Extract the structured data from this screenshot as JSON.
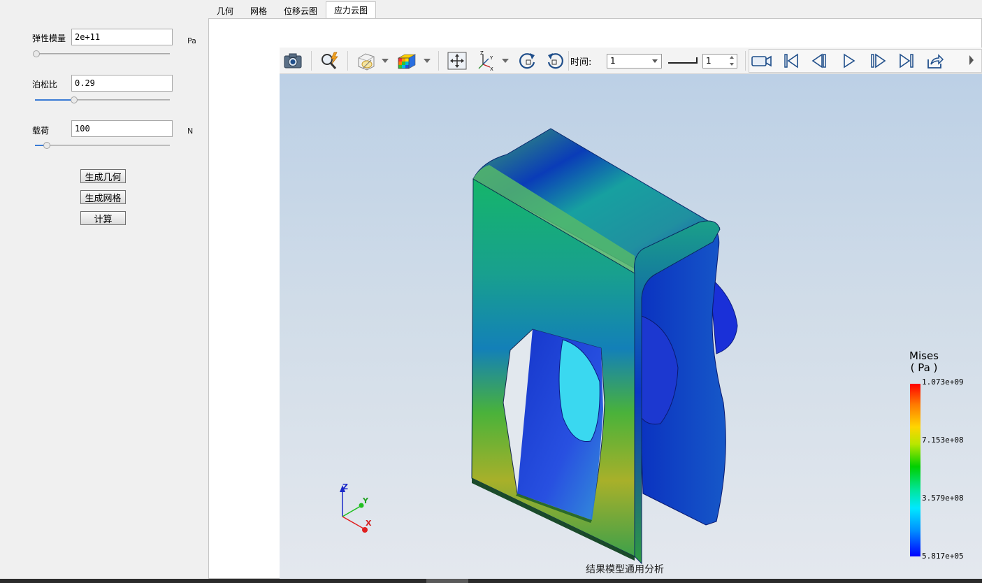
{
  "params": {
    "elastic_modulus": {
      "label": "弹性模量",
      "value": "2e+11",
      "unit": "Pa",
      "slider_fraction": 0.01
    },
    "poisson_ratio": {
      "label": "泊松比",
      "value": "0.29",
      "slider_fraction": 0.29
    },
    "load": {
      "label": "载荷",
      "value": "100",
      "unit": "N",
      "slider_fraction": 0.09
    }
  },
  "actions": {
    "gen_geometry": "生成几何",
    "gen_mesh": "生成网格",
    "compute": "计算"
  },
  "tabs": [
    {
      "label": "几何",
      "active": false
    },
    {
      "label": "网格",
      "active": false
    },
    {
      "label": "位移云图",
      "active": false
    },
    {
      "label": "应力云图",
      "active": true
    }
  ],
  "toolbar": {
    "time_label": "时间:",
    "time_value": "1",
    "step_value": "1",
    "icons": [
      "camera-icon",
      "magnify-icon",
      "display-mode-icon",
      "color-cube-icon",
      "fit-view-icon",
      "axes-icon",
      "rotate-cw-icon",
      "rotate-ccw-icon",
      "video-icon",
      "first-frame-icon",
      "prev-frame-icon",
      "play-icon",
      "next-frame-icon",
      "last-frame-icon",
      "export-icon"
    ]
  },
  "viewport": {
    "caption": "结果模型通用分析",
    "axis_labels": {
      "x": "X",
      "y": "Y",
      "z": "Z"
    }
  },
  "legend": {
    "title_line1": "Mises",
    "title_line2": "( Pa )",
    "ticks": [
      "1.073e+09",
      "7.153e+08",
      "3.579e+08",
      "5.817e+05"
    ]
  },
  "colors": {
    "accent": "#3a7bd5",
    "stress_max": "#ff0000",
    "stress_min": "#0000ff"
  }
}
